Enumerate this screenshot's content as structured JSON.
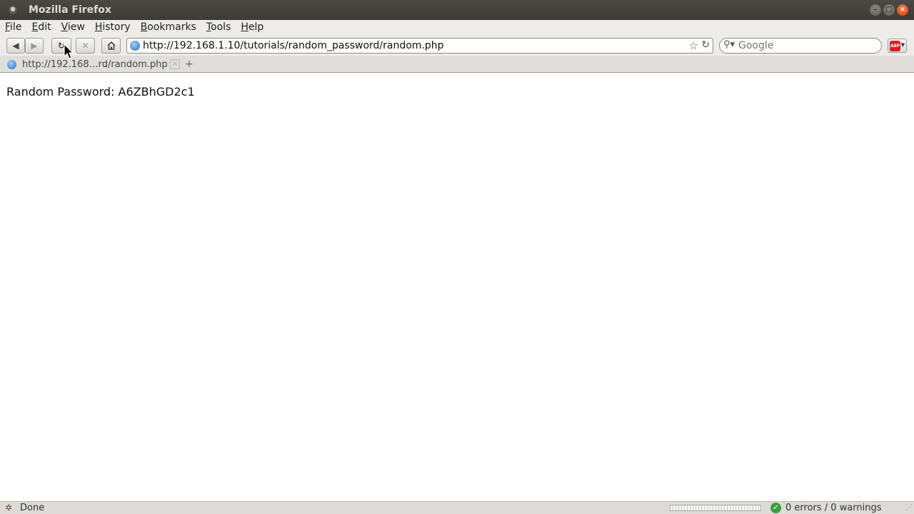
{
  "window": {
    "title": "Mozilla Firefox"
  },
  "menu": {
    "items": [
      {
        "label": "File",
        "accel": "F",
        "rest": "ile"
      },
      {
        "label": "Edit",
        "accel": "E",
        "rest": "dit"
      },
      {
        "label": "View",
        "accel": "V",
        "rest": "iew"
      },
      {
        "label": "History",
        "accel": "H",
        "rest": "istory"
      },
      {
        "label": "Bookmarks",
        "accel": "B",
        "rest": "ookmarks"
      },
      {
        "label": "Tools",
        "accel": "T",
        "rest": "ools"
      },
      {
        "label": "Help",
        "accel": "H",
        "rest": "elp"
      }
    ]
  },
  "toolbar": {
    "url": "http://192.168.1.10/tutorials/random_password/random.php",
    "search_placeholder": "Google",
    "addon_label": "ABP"
  },
  "tabs": [
    {
      "label": "http://192.168…rd/random.php",
      "active": true
    }
  ],
  "content": {
    "text": "Random Password: A6ZBhGD2c1"
  },
  "status": {
    "text": "Done",
    "validator": "0 errors / 0 warnings"
  },
  "icons": {
    "back": "back-arrow-icon",
    "forward": "forward-arrow-icon",
    "reload": "reload-icon",
    "stop": "stop-icon",
    "home": "home-icon",
    "bookmark": "star-icon",
    "search": "magnifier-icon",
    "site": "globe-icon"
  },
  "colors": {
    "titlebar": "#3c3b37",
    "chrome": "#edeceb",
    "close_button": "#e05a1a"
  }
}
